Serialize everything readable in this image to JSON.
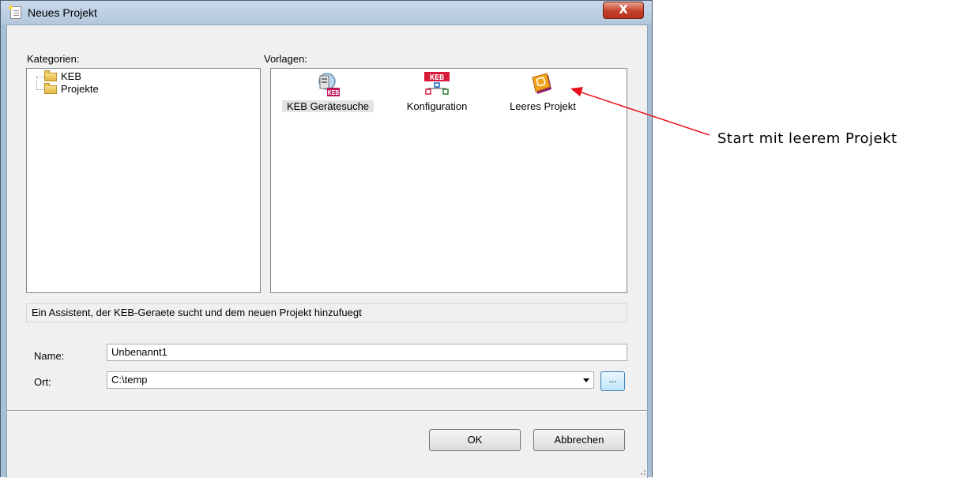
{
  "window": {
    "title": "Neues Projekt",
    "close_label": "X"
  },
  "categories": {
    "label": "Kategorien:",
    "items": [
      {
        "label": "KEB"
      },
      {
        "label": "Projekte"
      }
    ]
  },
  "templates": {
    "label": "Vorlagen:",
    "items": [
      {
        "label": "KEB Gerätesuche",
        "icon": "device-search-icon"
      },
      {
        "label": "Konfiguration",
        "icon": "configuration-icon"
      },
      {
        "label": "Leeres Projekt",
        "icon": "empty-project-icon"
      }
    ]
  },
  "description": "Ein Assistent, der KEB-Geraete sucht und dem neuen Projekt hinzufuegt",
  "form": {
    "name_label": "Name:",
    "name_value": "Unbenannt1",
    "location_label": "Ort:",
    "location_value": "C:\\temp",
    "browse_label": "..."
  },
  "buttons": {
    "ok": "OK",
    "cancel": "Abbrechen"
  },
  "annotation": {
    "text": "Start mit leerem Projekt",
    "color": "#e8101a"
  },
  "colors": {
    "accent": "#3c7fb1",
    "window_frame": "#a9bfd6",
    "close_button": "#c4402b"
  }
}
